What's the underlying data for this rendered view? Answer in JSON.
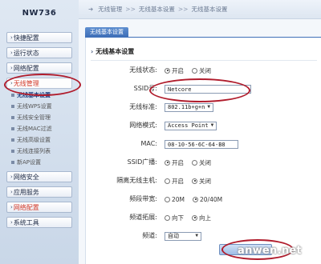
{
  "brand": {
    "model": "NW736"
  },
  "sidebar": {
    "items": [
      {
        "label": "快捷配置"
      },
      {
        "label": "运行状态"
      },
      {
        "label": "网络配置"
      },
      {
        "label": "无线管理"
      },
      {
        "label": "网络安全"
      },
      {
        "label": "应用服务"
      },
      {
        "label": "网络配置"
      },
      {
        "label": "系统工具"
      }
    ],
    "submenu": [
      {
        "label": "无线基本设置"
      },
      {
        "label": "无线WPS设置"
      },
      {
        "label": "无线安全管理"
      },
      {
        "label": "无线MAC过滤"
      },
      {
        "label": "无线高级设置"
      },
      {
        "label": "无线连接列表"
      },
      {
        "label": "新AP设置"
      }
    ]
  },
  "breadcrumb": {
    "parts": [
      "无线管理",
      "无线基本设置",
      "无线基本设置"
    ],
    "separator": ">>"
  },
  "tab": {
    "label": "无线基本设置"
  },
  "section": {
    "title": "无线基本设置"
  },
  "form": {
    "wireless_status": {
      "label": "无线状态:",
      "on": "开启",
      "off": "关闭",
      "selected": "on"
    },
    "ssid": {
      "label": "SSID号:",
      "value": "Netcore"
    },
    "standard": {
      "label": "无线标准:",
      "value": "802.11b+g+n"
    },
    "mode": {
      "label": "网络模式:",
      "value": "Access Point"
    },
    "mac": {
      "label": "MAC:",
      "value": "08-10-56-6C-64-B8"
    },
    "ssid_broadcast": {
      "label": "SSID广播:",
      "on": "开启",
      "off": "关闭",
      "selected": "on"
    },
    "isolation": {
      "label": "隔离无线主机:",
      "on": "开启",
      "off": "关闭",
      "selected": "off"
    },
    "bandwidth": {
      "label": "频段带宽:",
      "opt1": "20M",
      "opt2": "20/40M",
      "selected": "opt2"
    },
    "extension": {
      "label": "频道拓展:",
      "opt1": "向下",
      "opt2": "向上",
      "selected": "opt2"
    },
    "channel": {
      "label": "频道:",
      "value": "自动"
    }
  },
  "watermark": {
    "text": "anwen.net"
  },
  "colors": {
    "accent": "#3f6fb8",
    "highlight_ring": "#b01c2c"
  }
}
